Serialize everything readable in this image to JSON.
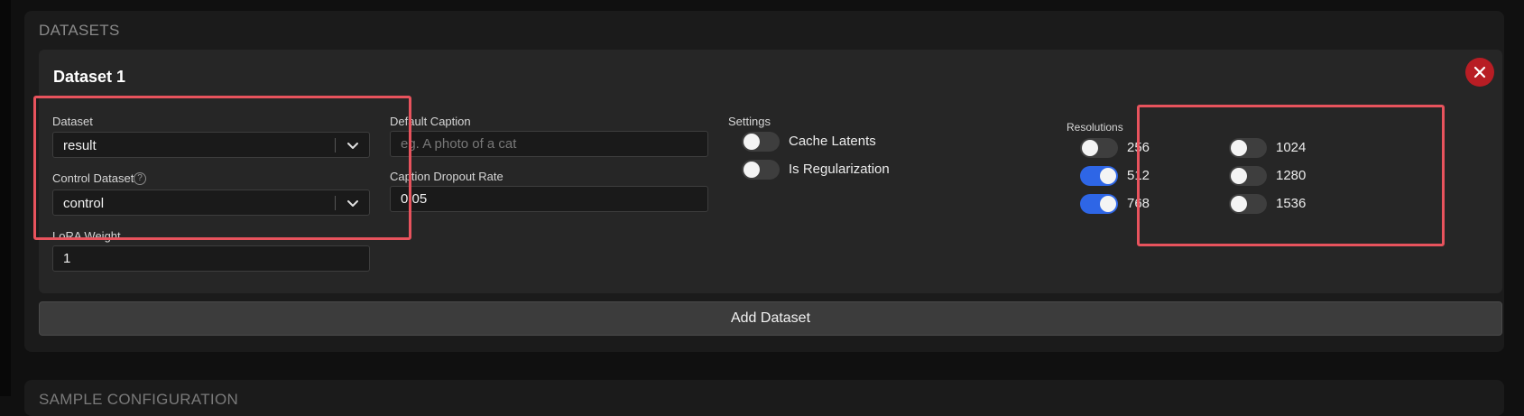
{
  "section": {
    "title": "DATASETS"
  },
  "next_section": {
    "title": "SAMPLE CONFIGURATION"
  },
  "dataset_card": {
    "title": "Dataset 1",
    "dataset": {
      "label": "Dataset",
      "value": "result"
    },
    "control_dataset": {
      "label": "Control Dataset",
      "value": "control",
      "help": "?"
    },
    "lora_weight": {
      "label": "LoRA Weight",
      "value": "1"
    },
    "default_caption": {
      "label": "Default Caption",
      "placeholder": "eg. A photo of a cat",
      "value": ""
    },
    "caption_dropout": {
      "label": "Caption Dropout Rate",
      "value": "0.05"
    },
    "settings": {
      "label": "Settings",
      "cache_latents": {
        "label": "Cache Latents",
        "on": false
      },
      "is_regularization": {
        "label": "Is Regularization",
        "on": false
      }
    },
    "resolutions": {
      "label": "Resolutions",
      "items": [
        {
          "label": "256",
          "on": false
        },
        {
          "label": "512",
          "on": true
        },
        {
          "label": "768",
          "on": true
        },
        {
          "label": "1024",
          "on": false
        },
        {
          "label": "1280",
          "on": false
        },
        {
          "label": "1536",
          "on": false
        }
      ]
    }
  },
  "add_dataset": {
    "label": "Add Dataset"
  },
  "colors": {
    "accent": "#2e66e6",
    "danger": "#b81d24",
    "highlight": "#e8535d"
  }
}
